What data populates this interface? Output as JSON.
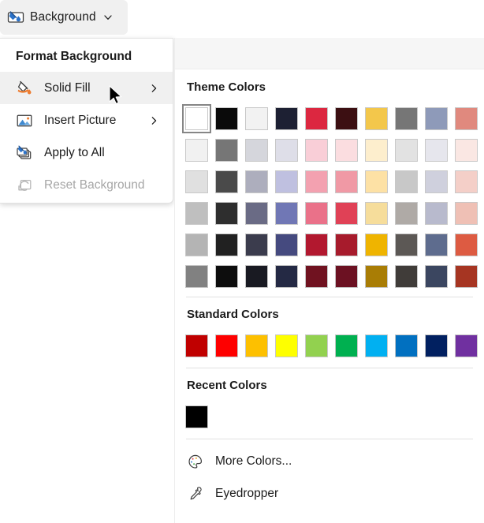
{
  "ribbon": {
    "button_label": "Background",
    "icon": "background-fill-icon",
    "chevron": "chevron-down-icon"
  },
  "menu": {
    "title": "Format Background",
    "items": [
      {
        "label": "Solid Fill",
        "icon": "paint-bucket-icon",
        "has_submenu": true,
        "disabled": false,
        "highlighted": true
      },
      {
        "label": "Insert Picture",
        "icon": "picture-icon",
        "has_submenu": true,
        "disabled": false,
        "highlighted": false
      },
      {
        "label": "Apply to All",
        "icon": "apply-to-all-icon",
        "has_submenu": false,
        "disabled": false,
        "highlighted": false
      },
      {
        "label": "Reset Background",
        "icon": "reset-icon",
        "has_submenu": false,
        "disabled": true,
        "highlighted": false
      }
    ]
  },
  "cursor": {
    "name": "mouse-pointer"
  },
  "panel": {
    "theme_colors": {
      "heading": "Theme Colors",
      "rows": [
        [
          "#ffffff",
          "#0a0a0a",
          "#f2f2f2",
          "#1d2033",
          "#dc2740",
          "#3c0f12",
          "#f3c74b",
          "#767676",
          "#8e9ab9",
          "#e0897e"
        ],
        [
          "#f1f1f1",
          "#767676",
          "#d5d6dc",
          "#dedee8",
          "#f9ced7",
          "#fbdde0",
          "#fdeecd",
          "#e2e2e2",
          "#e6e6ed",
          "#fae7e3"
        ],
        [
          "#e0e0e0",
          "#4a4a4a",
          "#adaebd",
          "#bfc0e0",
          "#f3a1b0",
          "#f099a5",
          "#fde1a5",
          "#c8c8c8",
          "#cfd0dd",
          "#f4cfc8"
        ],
        [
          "#bfbfbf",
          "#2e2e2e",
          "#6a6b85",
          "#7077b5",
          "#ea7189",
          "#e04156",
          "#f6dd9b",
          "#afaaa6",
          "#b8bacd",
          "#efc0b5"
        ],
        [
          "#b4b4b4",
          "#212121",
          "#3b3c4d",
          "#454a7f",
          "#b2182f",
          "#a71b2c",
          "#efb400",
          "#5c5855",
          "#5e6c8e",
          "#dd5b42"
        ],
        [
          "#818181",
          "#0d0d0d",
          "#191a22",
          "#242944",
          "#701220",
          "#6c1122",
          "#a97d05",
          "#403c39",
          "#3b4660",
          "#a63522"
        ]
      ],
      "selected_index": [
        0,
        0
      ]
    },
    "standard_colors": {
      "heading": "Standard Colors",
      "colors": [
        "#c00000",
        "#fe0000",
        "#fdc000",
        "#feff00",
        "#92d14f",
        "#00b050",
        "#01b0f1",
        "#0170c0",
        "#012060",
        "#7030a0"
      ]
    },
    "recent_colors": {
      "heading": "Recent Colors",
      "colors": [
        "#000000"
      ]
    },
    "commands": [
      {
        "label": "More Colors...",
        "icon": "palette-icon"
      },
      {
        "label": "Eyedropper",
        "icon": "eyedropper-icon"
      }
    ]
  }
}
